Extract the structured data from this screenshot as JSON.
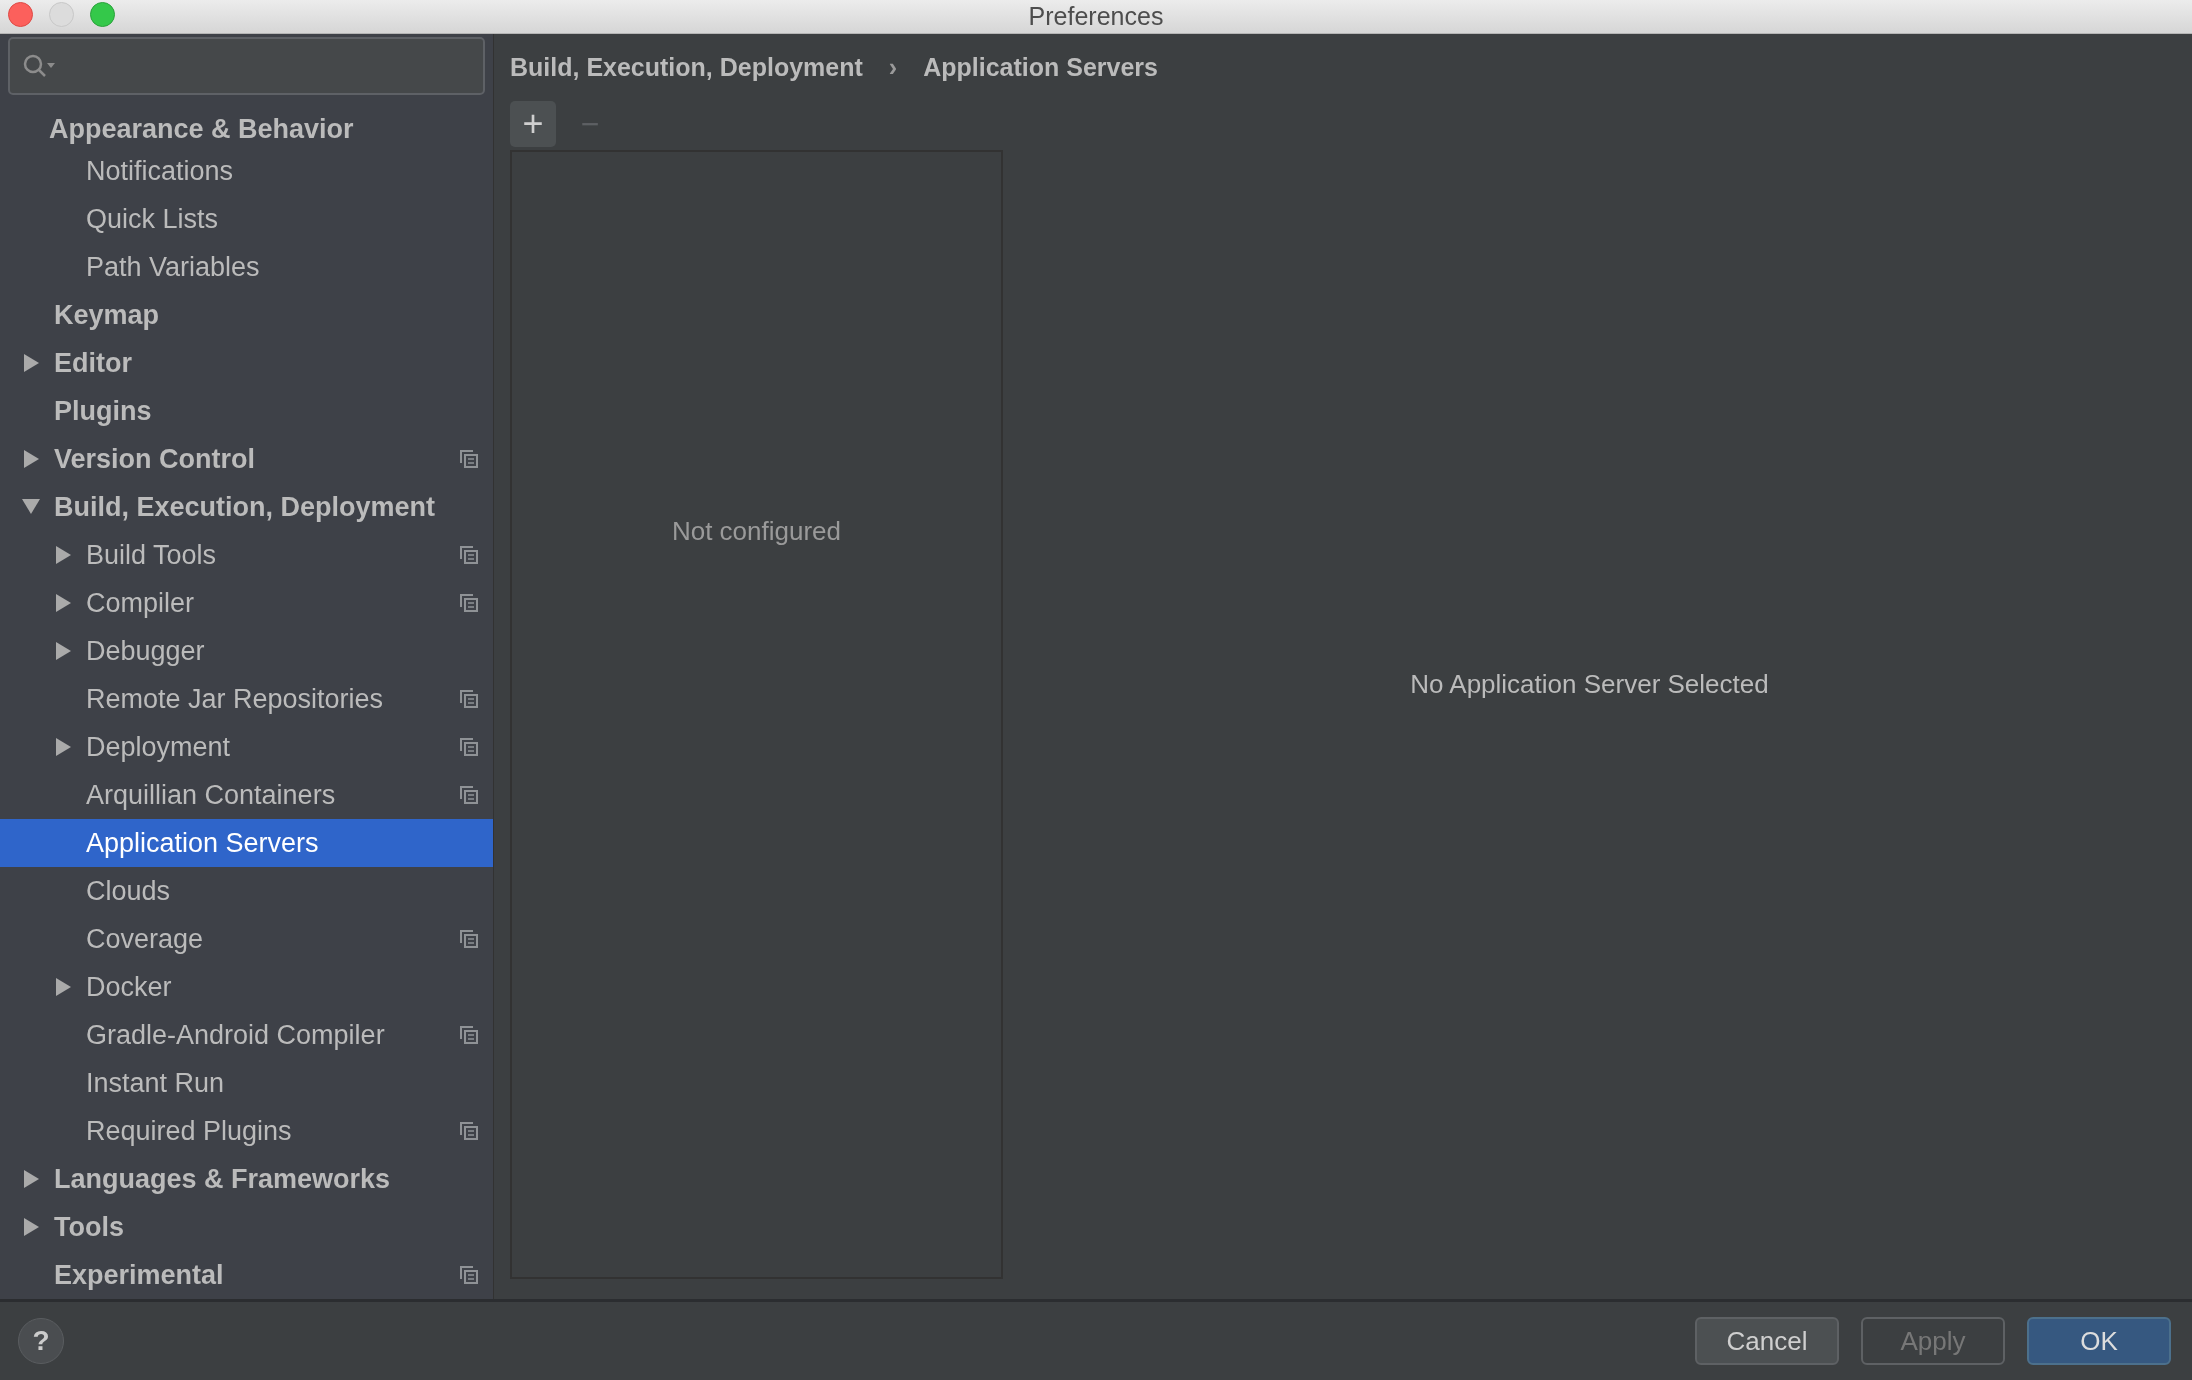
{
  "window": {
    "title": "Preferences"
  },
  "sidebar": {
    "items": [
      {
        "label": "Appearance & Behavior",
        "bold": true,
        "selected": false,
        "copy_icon": false,
        "children": [
          {
            "label": "Notifications",
            "selected": false,
            "copy_icon": false
          },
          {
            "label": "Quick Lists",
            "selected": false,
            "copy_icon": false
          },
          {
            "label": "Path Variables",
            "selected": false,
            "copy_icon": false
          }
        ]
      },
      {
        "label": "Keymap",
        "bold": true,
        "selected": false,
        "copy_icon": false
      },
      {
        "label": "Editor",
        "bold": true,
        "expanded": false,
        "selected": false,
        "copy_icon": false
      },
      {
        "label": "Plugins",
        "bold": true,
        "selected": false,
        "copy_icon": false
      },
      {
        "label": "Version Control",
        "bold": true,
        "expanded": false,
        "selected": false,
        "copy_icon": true
      },
      {
        "label": "Build, Execution, Deployment",
        "bold": true,
        "expanded": true,
        "selected": false,
        "copy_icon": false,
        "children": [
          {
            "label": "Build Tools",
            "expanded": false,
            "selected": false,
            "copy_icon": true
          },
          {
            "label": "Compiler",
            "expanded": false,
            "selected": false,
            "copy_icon": true
          },
          {
            "label": "Debugger",
            "expanded": false,
            "selected": false,
            "copy_icon": false
          },
          {
            "label": "Remote Jar Repositories",
            "selected": false,
            "copy_icon": true
          },
          {
            "label": "Deployment",
            "expanded": false,
            "selected": false,
            "copy_icon": true
          },
          {
            "label": "Arquillian Containers",
            "selected": false,
            "copy_icon": true
          },
          {
            "label": "Application Servers",
            "selected": true,
            "copy_icon": false
          },
          {
            "label": "Clouds",
            "selected": false,
            "copy_icon": false
          },
          {
            "label": "Coverage",
            "selected": false,
            "copy_icon": true
          },
          {
            "label": "Docker",
            "expanded": false,
            "selected": false,
            "copy_icon": false
          },
          {
            "label": "Gradle-Android Compiler",
            "selected": false,
            "copy_icon": true
          },
          {
            "label": "Instant Run",
            "selected": false,
            "copy_icon": false
          },
          {
            "label": "Required Plugins",
            "selected": false,
            "copy_icon": true
          }
        ]
      },
      {
        "label": "Languages & Frameworks",
        "bold": true,
        "expanded": false,
        "selected": false,
        "copy_icon": false
      },
      {
        "label": "Tools",
        "bold": true,
        "expanded": false,
        "selected": false,
        "copy_icon": false
      },
      {
        "label": "Experimental",
        "bold": true,
        "selected": false,
        "copy_icon": true
      }
    ]
  },
  "breadcrumb": [
    "Build, Execution, Deployment",
    "Application Servers"
  ],
  "breadcrumb_separator": "›",
  "toolbar": {
    "add": "+",
    "remove": "−",
    "remove_disabled": true
  },
  "server_list": {
    "empty_text": "Not configured"
  },
  "detail": {
    "empty_text": "No Application Server Selected"
  },
  "help": "?",
  "buttons": [
    {
      "label": "Cancel",
      "kind": "normal"
    },
    {
      "label": "Apply",
      "kind": "disabled"
    },
    {
      "label": "OK",
      "kind": "default"
    }
  ]
}
